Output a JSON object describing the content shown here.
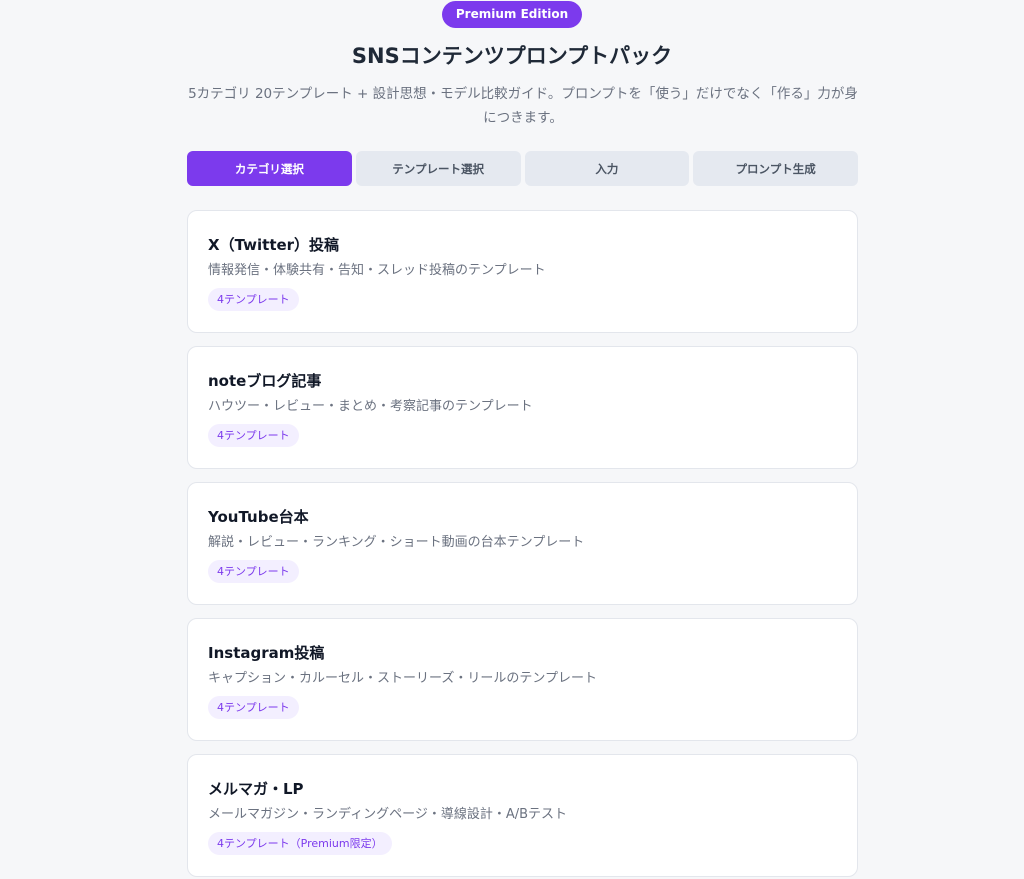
{
  "header": {
    "badge": "Premium Edition",
    "title": "SNSコンテンツプロンプトパック",
    "subtitle": "5カテゴリ 20テンプレート + 設計思想・モデル比較ガイド。プロンプトを「使う」だけでなく「作る」力が身につきます。"
  },
  "tabs": [
    {
      "label": "カテゴリ選択",
      "active": true
    },
    {
      "label": "テンプレート選択",
      "active": false
    },
    {
      "label": "入力",
      "active": false
    },
    {
      "label": "プロンプト生成",
      "active": false
    }
  ],
  "categories": [
    {
      "title": "X（Twitter）投稿",
      "description": "情報発信・体験共有・告知・スレッド投稿のテンプレート",
      "tag": "4テンプレート"
    },
    {
      "title": "noteブログ記事",
      "description": "ハウツー・レビュー・まとめ・考察記事のテンプレート",
      "tag": "4テンプレート"
    },
    {
      "title": "YouTube台本",
      "description": "解説・レビュー・ランキング・ショート動画の台本テンプレート",
      "tag": "4テンプレート"
    },
    {
      "title": "Instagram投稿",
      "description": "キャプション・カルーセル・ストーリーズ・リールのテンプレート",
      "tag": "4テンプレート"
    },
    {
      "title": "メルマガ・LP",
      "description": "メールマガジン・ランディングページ・導線設計・A/Bテスト",
      "tag": "4テンプレート（Premium限定）"
    }
  ],
  "colors": {
    "accent": "#7c3aed",
    "tab_inactive": "#e5e9f0",
    "tag_bg": "#f3efff",
    "background": "#f6f7f9"
  }
}
